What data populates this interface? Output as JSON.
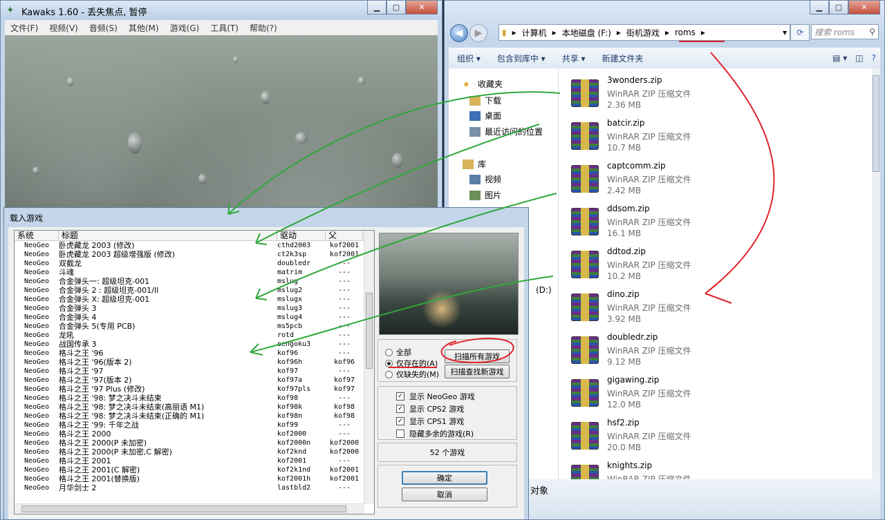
{
  "kawaks": {
    "title": "Kawaks 1.60 - 丢失焦点, 暂停",
    "menu": [
      "文件(F)",
      "视频(V)",
      "音频(S)",
      "其他(M)",
      "游戏(G)",
      "工具(T)",
      "帮助(?)"
    ]
  },
  "explorer": {
    "breadcrumb": [
      "计算机",
      "本地磁盘 (F:)",
      "街机游戏",
      "roms"
    ],
    "search_placeholder": "搜索 roms",
    "toolbar": [
      "组织 ▾",
      "包含到库中 ▾",
      "共享 ▾",
      "新建文件夹"
    ],
    "nav": {
      "favorites": "收藏夹",
      "downloads": "下载",
      "desktop": "桌面",
      "recent": "最近访问的位置",
      "library": "库",
      "video": "视频",
      "pictures": "图片",
      "drive_d": "(D:)"
    },
    "files": [
      {
        "name": "3wonders.zip",
        "type": "WinRAR ZIP 压缩文件",
        "size": "2.36 MB"
      },
      {
        "name": "batcir.zip",
        "type": "WinRAR ZIP 压缩文件",
        "size": "10.7 MB"
      },
      {
        "name": "captcomm.zip",
        "type": "WinRAR ZIP 压缩文件",
        "size": "2.42 MB"
      },
      {
        "name": "ddsom.zip",
        "type": "WinRAR ZIP 压缩文件",
        "size": "16.1 MB"
      },
      {
        "name": "ddtod.zip",
        "type": "WinRAR ZIP 压缩文件",
        "size": "10.2 MB"
      },
      {
        "name": "dino.zip",
        "type": "WinRAR ZIP 压缩文件",
        "size": "3.92 MB"
      },
      {
        "name": "doubledr.zip",
        "type": "WinRAR ZIP 压缩文件",
        "size": "9.12 MB"
      },
      {
        "name": "gigawing.zip",
        "type": "WinRAR ZIP 压缩文件",
        "size": "12.0 MB"
      },
      {
        "name": "hsf2.zip",
        "type": "WinRAR ZIP 压缩文件",
        "size": "20.0 MB"
      },
      {
        "name": "knights.zip",
        "type": "WinRAR ZIP 压缩文件",
        "size": ""
      }
    ],
    "status": "对象"
  },
  "dialog": {
    "title": "载入游戏",
    "columns": [
      "系统",
      "标题",
      "驱动",
      "父"
    ],
    "rows": [
      [
        "NeoGeo",
        "卧虎藏龙 2003 (修改)",
        "cthd2003",
        "kof2001"
      ],
      [
        "NeoGeo",
        "卧虎藏龙 2003 超级增强版 (修改)",
        "ct2k3sp",
        "kof2001"
      ],
      [
        "NeoGeo",
        "双截龙",
        "doubledr",
        "---"
      ],
      [
        "NeoGeo",
        "斗魂",
        "matrim",
        "---"
      ],
      [
        "NeoGeo",
        "合金弹头一: 超级坦克-001",
        "mslug",
        "---"
      ],
      [
        "NeoGeo",
        "合金弹头 2 : 超级坦克-001/II",
        "mslug2",
        "---"
      ],
      [
        "NeoGeo",
        "合金弹头 X: 超级坦克-001",
        "mslugx",
        "---"
      ],
      [
        "NeoGeo",
        "合金弹头 3",
        "mslug3",
        "---"
      ],
      [
        "NeoGeo",
        "合金弹头 4",
        "mslug4",
        "---"
      ],
      [
        "NeoGeo",
        "合金弹头 5(专用 PCB)",
        "ms5pcb",
        "---"
      ],
      [
        "NeoGeo",
        "龙吼",
        "rotd",
        "---"
      ],
      [
        "NeoGeo",
        "战国传承 3",
        "sengoku3",
        "---"
      ],
      [
        "NeoGeo",
        "格斗之王 '96",
        "kof96",
        "---"
      ],
      [
        "NeoGeo",
        "格斗之王 '96(版本 2)",
        "kof96h",
        "kof96"
      ],
      [
        "NeoGeo",
        "格斗之王 '97",
        "kof97",
        "---"
      ],
      [
        "NeoGeo",
        "格斗之王 '97(版本 2)",
        "kof97a",
        "kof97"
      ],
      [
        "NeoGeo",
        "格斗之王 '97 Plus (修改)",
        "kof97pls",
        "kof97"
      ],
      [
        "NeoGeo",
        "格斗之王 '98: 梦之决斗未结束",
        "kof98",
        "---"
      ],
      [
        "NeoGeo",
        "格斗之王 '98: 梦之决斗未结束(高丽语 M1)",
        "kof98k",
        "kof98"
      ],
      [
        "NeoGeo",
        "格斗之王 '98: 梦之决斗未结束(正确的 M1)",
        "kof98n",
        "kof98"
      ],
      [
        "NeoGeo",
        "格斗之王 '99: 千年之战",
        "kof99",
        "---"
      ],
      [
        "NeoGeo",
        "格斗之王 2000",
        "kof2000",
        "---"
      ],
      [
        "NeoGeo",
        "格斗之王 2000(P 未加密)",
        "kof2000n",
        "kof2000"
      ],
      [
        "NeoGeo",
        "格斗之王 2000(P 未加密,C 解密)",
        "kof2knd",
        "kof2000"
      ],
      [
        "NeoGeo",
        "格斗之王 2001",
        "kof2001",
        "---"
      ],
      [
        "NeoGeo",
        "格斗之王 2001(C 解密)",
        "kof2k1nd",
        "kof2001"
      ],
      [
        "NeoGeo",
        "格斗之王 2001(替换版)",
        "kof2001h",
        "kof2001"
      ],
      [
        "NeoGeo",
        "月华剑士 2",
        "lastbld2",
        "---"
      ]
    ],
    "radio_all": "全部",
    "radio_existing": "仅存在的(A)",
    "radio_missing": "仅缺失的(M)",
    "scan_all": "扫描所有游戏",
    "scan_new": "扫描查找新游戏",
    "chk_neogeo": "显示 NeoGeo 游戏",
    "chk_cps2": "显示 CPS2 游戏",
    "chk_cps1": "显示 CPS1 游戏",
    "chk_hide": "隐藏多余的游戏(R)",
    "count": "52 个游戏",
    "ok": "确定",
    "cancel": "取消"
  }
}
